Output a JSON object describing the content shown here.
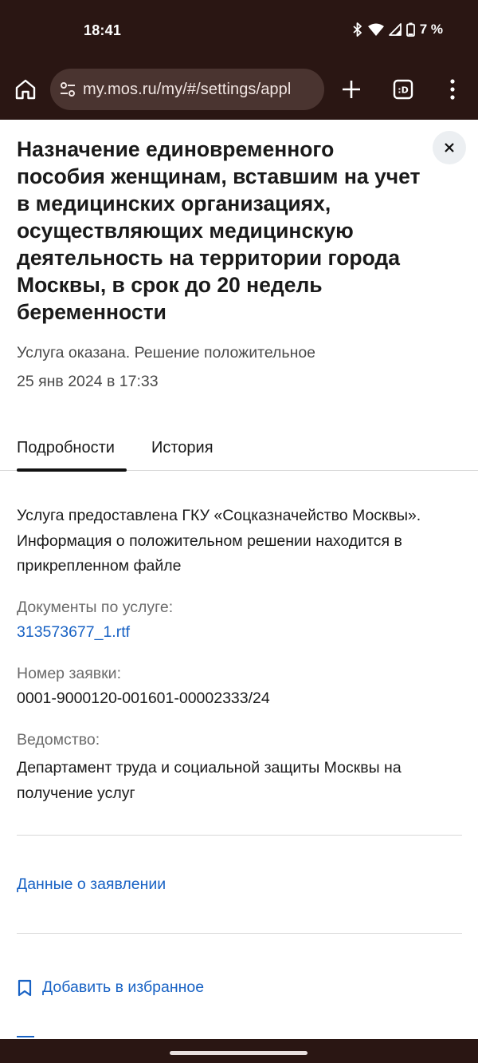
{
  "status_bar": {
    "time": "18:41",
    "battery_text": "7 %",
    "icons": [
      "bluetooth-icon",
      "wifi-icon",
      "cellular-icon",
      "battery-icon"
    ]
  },
  "browser": {
    "url": "my.mos.ru/my/#/settings/appl",
    "icons": [
      "home-icon",
      "site-settings-icon",
      "new-tab-icon",
      "tab-switcher-icon",
      "overflow-menu-icon"
    ],
    "tab_switcher_label": ":D"
  },
  "page": {
    "title": "Назначение единовременного пособия женщинам, вставшим на учет в медицинских организациях, осуществляющих медицинскую деятельность на территории города Москвы, в срок до 20 недель беременности",
    "status": "Услуга оказана. Решение положительное",
    "date": "25 янв 2024 в 17:33",
    "tabs": [
      {
        "label": "Подробности",
        "active": true
      },
      {
        "label": "История",
        "active": false
      }
    ],
    "details": {
      "description": "Услуга предоставлена ГКУ «Соцказначейство Москвы». Информация о положительном решении находится в прикрепленном файле",
      "documents_label": "Документы по услуге:",
      "document_link": "313573677_1.rtf",
      "request_number_label": "Номер заявки:",
      "request_number": "0001-9000120-001601-00002333/24",
      "agency_label": "Ведомство:",
      "agency": "Департамент труда и социальной защиты Москвы на получение услуг"
    },
    "application_data_link": "Данные о заявлении",
    "add_favorite_label": "Добавить в избранное"
  },
  "colors": {
    "chrome_bg": "#2a1613",
    "url_pill_bg": "#4a3430",
    "link": "#1862c4",
    "text": "#1a1a1a",
    "muted": "#6b6b6b"
  }
}
